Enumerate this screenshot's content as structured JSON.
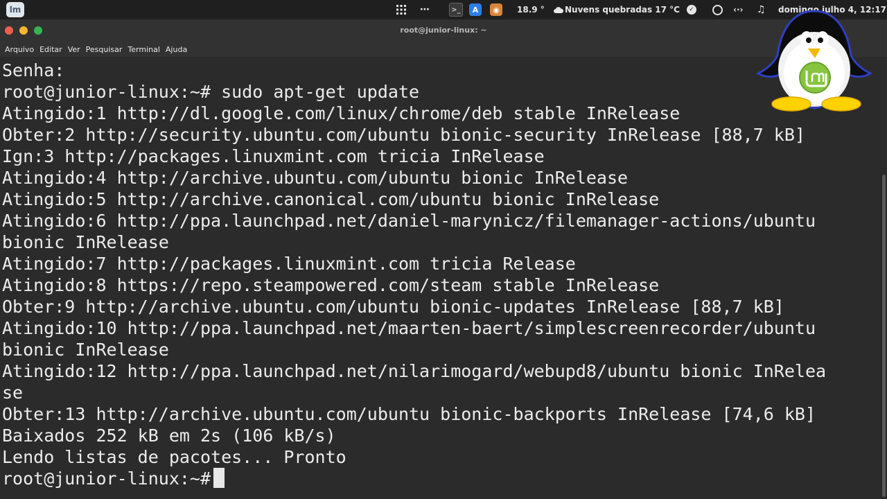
{
  "panel": {
    "temp_value": "18.9 °",
    "weather_label": "Nuvens quebradas 17 °C",
    "datetime": "domingo julho  4, 12:17",
    "icons": [
      "mint-menu-icon",
      "apps-grid-icon",
      "more-dots-icon",
      "terminal-launcher-icon",
      "software-store-icon",
      "gimp-launcher-icon",
      "cloud-icon",
      "check-circle-icon",
      "user-circle-icon",
      "network-arrows-icon",
      "music-note-icon"
    ]
  },
  "window": {
    "title": "root@junior-linux: ~",
    "controls": {
      "close": "#e95f4f",
      "minimize": "#f5b530",
      "maximize": "#36b44f"
    }
  },
  "menubar": {
    "items": [
      "Arquivo",
      "Editar",
      "Ver",
      "Pesquisar",
      "Terminal",
      "Ajuda"
    ]
  },
  "terminal": {
    "lines": [
      "Senha:",
      "root@junior-linux:~# sudo apt-get update",
      "Atingido:1 http://dl.google.com/linux/chrome/deb stable InRelease",
      "Obter:2 http://security.ubuntu.com/ubuntu bionic-security InRelease [88,7 kB]",
      "Ign:3 http://packages.linuxmint.com tricia InRelease",
      "Atingido:4 http://archive.ubuntu.com/ubuntu bionic InRelease",
      "Atingido:5 http://archive.canonical.com/ubuntu bionic InRelease",
      "Atingido:6 http://ppa.launchpad.net/daniel-marynicz/filemanager-actions/ubuntu",
      "bionic InRelease",
      "Atingido:7 http://packages.linuxmint.com tricia Release",
      "Atingido:8 https://repo.steampowered.com/steam stable InRelease",
      "Obter:9 http://archive.ubuntu.com/ubuntu bionic-updates InRelease [88,7 kB]",
      "Atingido:10 http://ppa.launchpad.net/maarten-baert/simplescreenrecorder/ubuntu",
      "bionic InRelease",
      "Atingido:12 http://ppa.launchpad.net/nilarimogard/webupd8/ubuntu bionic InRelea",
      "se",
      "Obter:13 http://archive.ubuntu.com/ubuntu bionic-backports InRelease [74,6 kB]",
      "Baixados 252 kB em 2s (106 kB/s)",
      "Lendo listas de pacotes... Pronto"
    ],
    "prompt": "root@junior-linux:~#"
  },
  "mascot": {
    "icon": "linux-mint-penguin-icon",
    "accent": "#87c540"
  }
}
